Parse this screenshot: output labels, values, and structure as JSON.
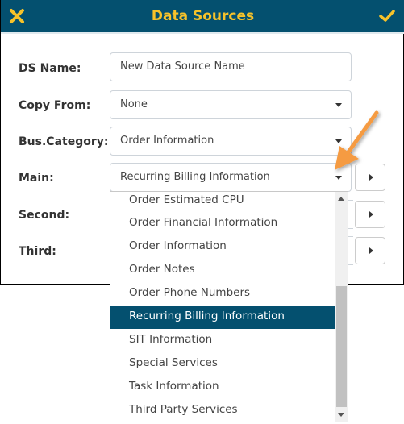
{
  "dialog": {
    "title": "Data Sources",
    "close_icon": "close-x-icon",
    "confirm_icon": "checkmark-icon",
    "colors": {
      "header_bg": "#04506f",
      "header_text": "#f7c22a",
      "selected_bg": "#04506f",
      "annotation_arrow": "#f59b43"
    }
  },
  "form": {
    "ds_name": {
      "label": "DS Name:",
      "value": "New Data Source Name"
    },
    "copy_from": {
      "label": "Copy From:",
      "value": "None"
    },
    "bus_category": {
      "label": "Bus.Category:",
      "value": "Order Information"
    },
    "main": {
      "label": "Main:",
      "value": "Recurring Billing Information"
    },
    "second": {
      "label": "Second:"
    },
    "third": {
      "label": "Third:"
    }
  },
  "main_dropdown": {
    "options": [
      "Order Estimated CPU",
      "Order Financial Information",
      "Order Information",
      "Order Notes",
      "Order Phone Numbers",
      "Recurring Billing Information",
      "SIT Information",
      "Special Services",
      "Task Information",
      "Third Party Services"
    ],
    "selected": "Recurring Billing Information"
  }
}
